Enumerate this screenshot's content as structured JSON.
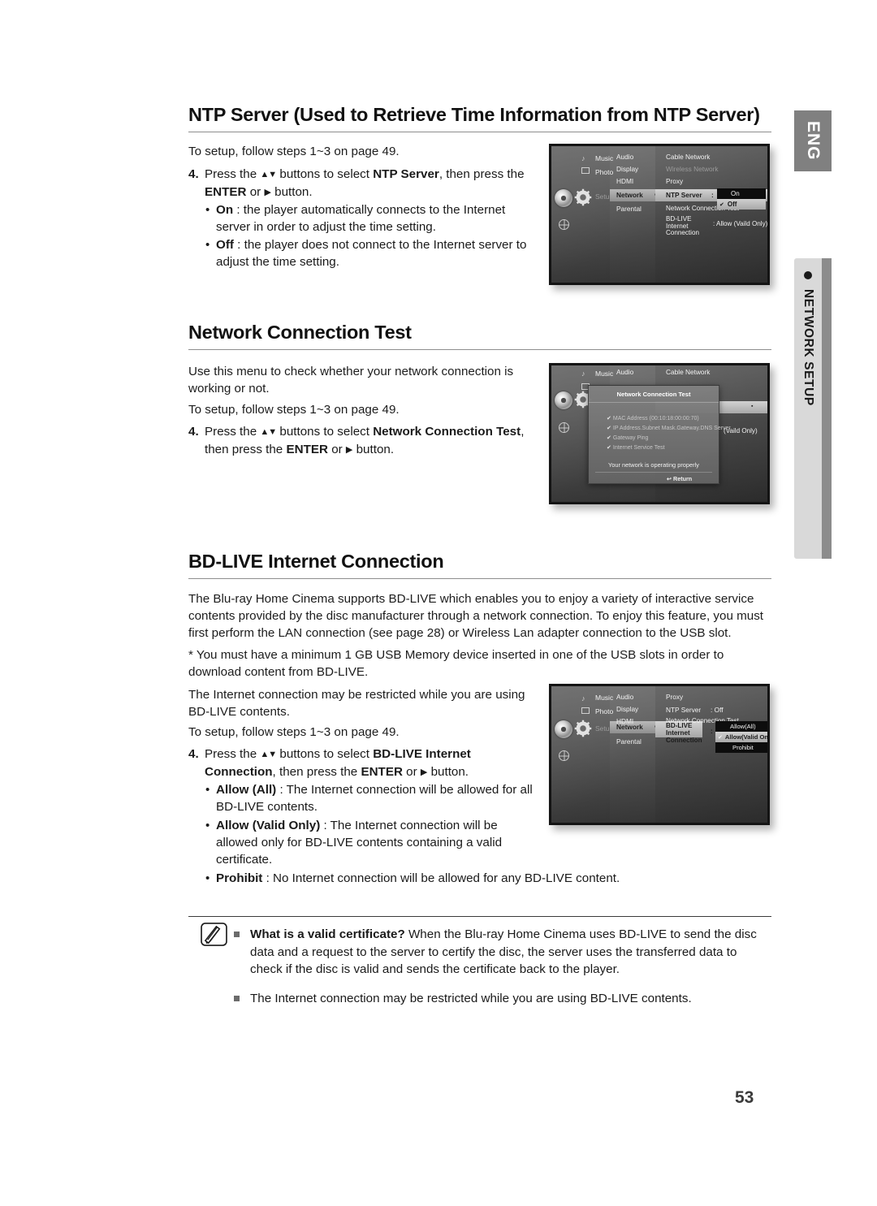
{
  "page": {
    "number": "53",
    "language_tab": "ENG",
    "chapter_tab": "NETWORK SETUP"
  },
  "sections": [
    {
      "id": "ntp-server",
      "title": "NTP Server (Used to Retrieve Time Information from NTP Server)",
      "intro": "To setup, follow steps 1~3 on page 49.",
      "step": {
        "num": "4.",
        "text_1": "Press the ",
        "arrows": "▲▼",
        "text_2": " buttons to select ",
        "bold_1": "NTP Server",
        "text_3": ", then press the ",
        "bold_2": "ENTER",
        "text_4": " or ",
        "right_arrow": "▶",
        "text_5": " button."
      },
      "bullets": [
        {
          "label": "On",
          "text": " : the player automatically connects to the Internet server in order to adjust the time setting."
        },
        {
          "label": "Off",
          "text": " : the player does not connect to the Internet server to adjust the time setting."
        }
      ]
    },
    {
      "id": "network-connection-test",
      "title": "Network Connection Test",
      "intro_1": "Use this menu to check whether your network connection is working or not.",
      "intro_2": "To setup, follow steps 1~3 on page 49.",
      "step": {
        "num": "4.",
        "text_1": "Press the ",
        "arrows": "▲▼",
        "text_2": " buttons to select ",
        "bold_1": "Network Connection Test",
        "text_3": ", then press the ",
        "bold_2": "ENTER",
        "text_4": " or ",
        "right_arrow": "▶",
        "text_5": " button."
      }
    },
    {
      "id": "bd-live-internet-connection",
      "title": "BD-LIVE Internet Connection",
      "para_1": "The Blu-ray Home Cinema supports BD-LIVE which enables you to enjoy a variety of interactive service contents provided by the disc manufacturer through a network connection. To enjoy this feature, you must first perform the LAN connection (see page 28) or Wireless Lan adapter connection to the USB slot.",
      "para_2": "* You must have a minimum 1 GB USB Memory device inserted in one of the USB slots in order to download content from BD-LIVE.",
      "para_3": "The Internet connection may be restricted while you are using BD-LIVE contents.",
      "para_4": "To setup, follow steps 1~3 on page 49.",
      "step": {
        "num": "4.",
        "text_1": "Press the ",
        "arrows": "▲▼",
        "text_2": " buttons to select ",
        "bold_1": "BD-LIVE Internet Connection",
        "text_3": ", then press the ",
        "bold_2": "ENTER",
        "text_4": " or ",
        "right_arrow": "▶",
        "text_5": " button."
      },
      "bullets": [
        {
          "label": "Allow (All)",
          "text": " : The Internet connection will be allowed for all BD-LIVE contents."
        },
        {
          "label": "Allow (Valid Only)",
          "text": " : The Internet connection will be allowed only for BD-LIVE contents containing a valid certificate."
        },
        {
          "label": "Prohibit",
          "text": " : No Internet connection will be allowed for any BD-LIVE content."
        }
      ]
    }
  ],
  "note": {
    "items": [
      {
        "bold": "What is a valid certificate?",
        "text": " When the Blu-ray Home Cinema uses BD-LIVE to send the disc data and a request to the server to certify the disc, the server uses the transferred data to check if the disc is valid and sends the certificate back to the player."
      },
      {
        "bold": "",
        "text": "The Internet connection may be restricted while you are using BD-LIVE contents."
      }
    ]
  },
  "screenshots": {
    "ntp": {
      "left_menu": [
        "Music",
        "Photo",
        "Setup"
      ],
      "mid_menu": [
        "Audio",
        "Display",
        "HDMI",
        "Network",
        "Parental"
      ],
      "mid_selected": "Network",
      "right_menu": [
        {
          "label": "Cable Network",
          "value": "",
          "dim": false
        },
        {
          "label": "Wireless Network",
          "value": "",
          "dim": true
        },
        {
          "label": "Proxy",
          "value": "",
          "dim": false
        },
        {
          "label": "NTP Server",
          "value": ":",
          "dim": false
        },
        {
          "label": "Network Connection Test",
          "value": "",
          "dim": false
        },
        {
          "label": "BD-LIVE Internet Connection",
          "value": ": Allow (Vaild Only)",
          "dim": false
        }
      ],
      "dropdown": [
        {
          "label": "On",
          "checked": false,
          "highlighted": true
        },
        {
          "label": "Off",
          "checked": true,
          "highlighted": false
        }
      ]
    },
    "test": {
      "left_menu": [
        "Music"
      ],
      "mid_menu": [
        "Audio"
      ],
      "right_menu": [
        "Cable Network"
      ],
      "partial_right": "(Vaild Only)",
      "dialog": {
        "title": "Network Connection Test",
        "lines": [
          "MAC Address (00:10:18:00:00:70)",
          "IP Address.Subnet Mask.Gateway.DNS Server",
          "Gateway Ping",
          "Internet Service Test"
        ],
        "status": "Your network is operating properly",
        "return_label": "Return",
        "check_glyph": "✔",
        "return_glyph": "↩"
      }
    },
    "bdlive": {
      "left_menu": [
        "Music",
        "Photo",
        "Setup"
      ],
      "mid_menu": [
        "Audio",
        "Display",
        "HDMI",
        "Network",
        "Parental"
      ],
      "mid_selected": "Network",
      "right_menu": [
        {
          "label": "Proxy",
          "value": "",
          "dim": false
        },
        {
          "label": "NTP Server",
          "value": ": Off",
          "dim": false
        },
        {
          "label": "Network Connection Test",
          "value": "",
          "dim": false
        },
        {
          "label": "BD-LIVE Internet Connection",
          "value": ":",
          "dim": false
        }
      ],
      "dropdown": [
        {
          "label": "Allow(All)",
          "checked": false,
          "style": "dark"
        },
        {
          "label": "Allow(Valid Only)",
          "checked": true,
          "style": "light"
        },
        {
          "label": "Prohibit",
          "checked": false,
          "style": "dark"
        }
      ]
    }
  }
}
